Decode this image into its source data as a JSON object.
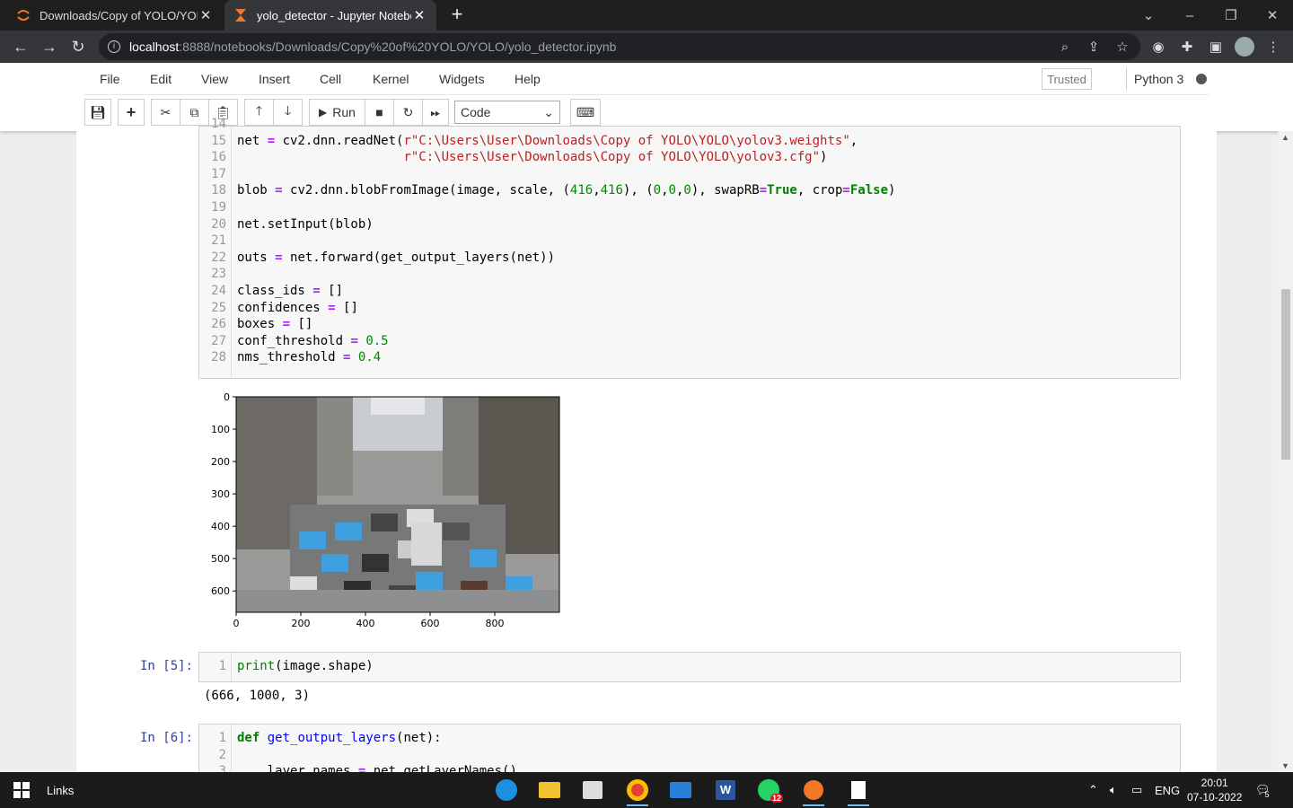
{
  "browser": {
    "tabs": [
      {
        "title": "Downloads/Copy of YOLO/YOLO",
        "active": false
      },
      {
        "title": "yolo_detector - Jupyter Noteboo",
        "active": true
      }
    ],
    "url_host": "localhost",
    "url_path": ":8888/notebooks/Downloads/Copy%20of%20YOLO/YOLO/yolo_detector.ipynb"
  },
  "jupyter": {
    "menu": [
      "File",
      "Edit",
      "View",
      "Insert",
      "Cell",
      "Kernel",
      "Widgets",
      "Help"
    ],
    "trusted_label": "Trusted",
    "kernel_name": "Python 3",
    "run_label": "Run",
    "cell_type": "Code"
  },
  "cells": {
    "cell4_lines": [
      {
        "n": "14",
        "code": ""
      },
      {
        "n": "15",
        "code": "net = cv2.dnn.readNet(r\"C:\\Users\\User\\Downloads\\Copy of YOLO\\YOLO\\yolov3.weights\","
      },
      {
        "n": "16",
        "code": "                      r\"C:\\Users\\User\\Downloads\\Copy of YOLO\\YOLO\\yolov3.cfg\")"
      },
      {
        "n": "17",
        "code": ""
      },
      {
        "n": "18",
        "code": "blob = cv2.dnn.blobFromImage(image, scale, (416,416), (0,0,0), swapRB=True, crop=False)"
      },
      {
        "n": "19",
        "code": ""
      },
      {
        "n": "20",
        "code": "net.setInput(blob)"
      },
      {
        "n": "21",
        "code": ""
      },
      {
        "n": "22",
        "code": "outs = net.forward(get_output_layers(net))"
      },
      {
        "n": "23",
        "code": ""
      },
      {
        "n": "24",
        "code": "class_ids = []"
      },
      {
        "n": "25",
        "code": "confidences = []"
      },
      {
        "n": "26",
        "code": "boxes = []"
      },
      {
        "n": "27",
        "code": "conf_threshold = 0.5"
      },
      {
        "n": "28",
        "code": "nms_threshold = 0.4"
      }
    ],
    "cell5_prompt": "In [5]:",
    "cell5_lines": [
      {
        "n": "1",
        "code": "print(image.shape)"
      }
    ],
    "cell5_output": "(666, 1000, 3)",
    "cell6_prompt": "In [6]:",
    "cell6_lines": [
      {
        "n": "1",
        "code": "def get_output_layers(net):"
      },
      {
        "n": "2",
        "code": ""
      },
      {
        "n": "3",
        "code": "    layer_names = net.getLayerNames()"
      }
    ]
  },
  "chart_data": {
    "type": "image",
    "x_ticks": [
      "0",
      "200",
      "400",
      "600",
      "800"
    ],
    "y_ticks": [
      "0",
      "100",
      "200",
      "300",
      "400",
      "500",
      "600"
    ],
    "xlim": [
      0,
      1000
    ],
    "ylim": [
      666,
      0
    ]
  },
  "taskbar": {
    "search_label": "Links",
    "lang": "ENG",
    "time": "20:01",
    "date": "07-10-2022",
    "whatsapp_badge": "12",
    "notifications": "5",
    "colors": {
      "edge": "#1e8fe0",
      "explorer": "#f2c230",
      "chrome": "#e34133",
      "mail": "#2a7fd9",
      "word": "#2b579a",
      "whatsapp": "#25d366",
      "jupyter": "#f37726"
    }
  }
}
